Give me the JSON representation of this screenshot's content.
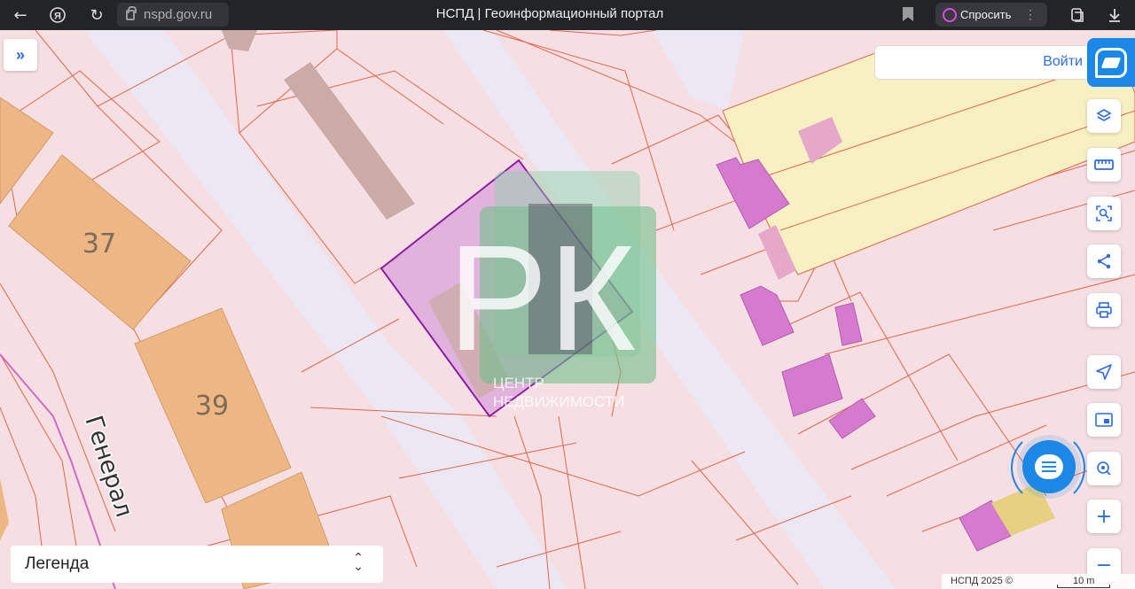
{
  "browser": {
    "url": "nspd.gov.ru",
    "title": "НСПД | Геоинформационный портал",
    "ask_label": "Спросить"
  },
  "map": {
    "login_label": "Войти",
    "parcel_numbers": [
      "37",
      "39"
    ],
    "street_label": "Генерал",
    "watermark_letters": "РК",
    "watermark_line1": "ЦЕНТР",
    "watermark_line2": "НЕДВИЖИМОСТИ",
    "legend_label": "Легенда",
    "attribution": "НСПД 2025 ©",
    "scale_label": "10 m"
  },
  "colors": {
    "background": "#f5dfe3",
    "parcel_border": "#e4644a",
    "building_orange": "#edb783",
    "building_magenta": "#d67ad0",
    "zone_yellow": "#f7f0c2",
    "selected_parcel": "#8b1ca6",
    "accent": "#1b87e6"
  },
  "tools": [
    {
      "name": "layers-icon"
    },
    {
      "name": "ruler-icon"
    },
    {
      "name": "select-area-icon"
    },
    {
      "name": "share-icon"
    },
    {
      "name": "print-icon"
    },
    {
      "name": "geolocation-icon"
    },
    {
      "name": "minimap-icon"
    },
    {
      "name": "search-point-icon"
    },
    {
      "name": "zoom-in-icon"
    },
    {
      "name": "zoom-out-icon"
    }
  ]
}
